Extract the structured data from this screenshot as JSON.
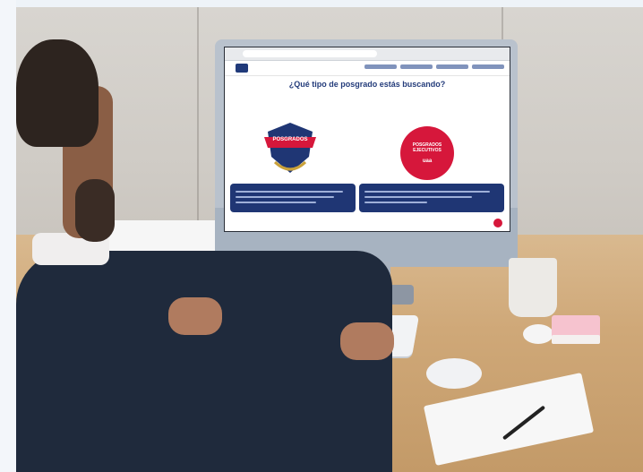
{
  "screen": {
    "headline": "¿Qué tipo de posgrado estás buscando?",
    "badge_left_text": "POSGRADOS",
    "badge_right_text": "POSGRADOS EJECUTIVOS",
    "badge_right_sub": "uaa"
  },
  "colors": {
    "primary": "#1f3674",
    "accent": "#d6173b",
    "wall": "#d3cfc9",
    "desk": "#cfa878"
  }
}
